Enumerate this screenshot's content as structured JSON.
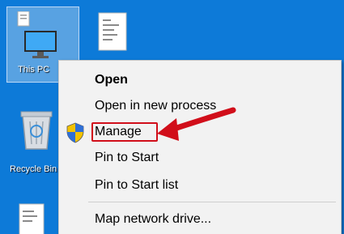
{
  "desktop": {
    "icons": [
      {
        "label": "This PC",
        "icon": "this-pc-icon"
      },
      {
        "label": "",
        "icon": "document-icon"
      },
      {
        "label": "Recycle Bin",
        "icon": "recycle-bin-icon"
      },
      {
        "label": "",
        "icon": "document-icon"
      }
    ]
  },
  "context_menu": {
    "items": [
      {
        "label": "Open",
        "bold": true
      },
      {
        "label": "Open in new process"
      },
      {
        "label": "Manage",
        "icon": "uac-shield-icon",
        "highlighted": true
      },
      {
        "label": "Pin to Start"
      },
      {
        "label": "Pin to Start list"
      },
      {
        "label": "Map network drive..."
      }
    ]
  },
  "annotation": {
    "arrow_color": "#d10e1a",
    "box_color": "#d10e1a"
  },
  "colors": {
    "desktop_bg": "#0d7ad8",
    "menu_bg": "#f2f2f2"
  }
}
